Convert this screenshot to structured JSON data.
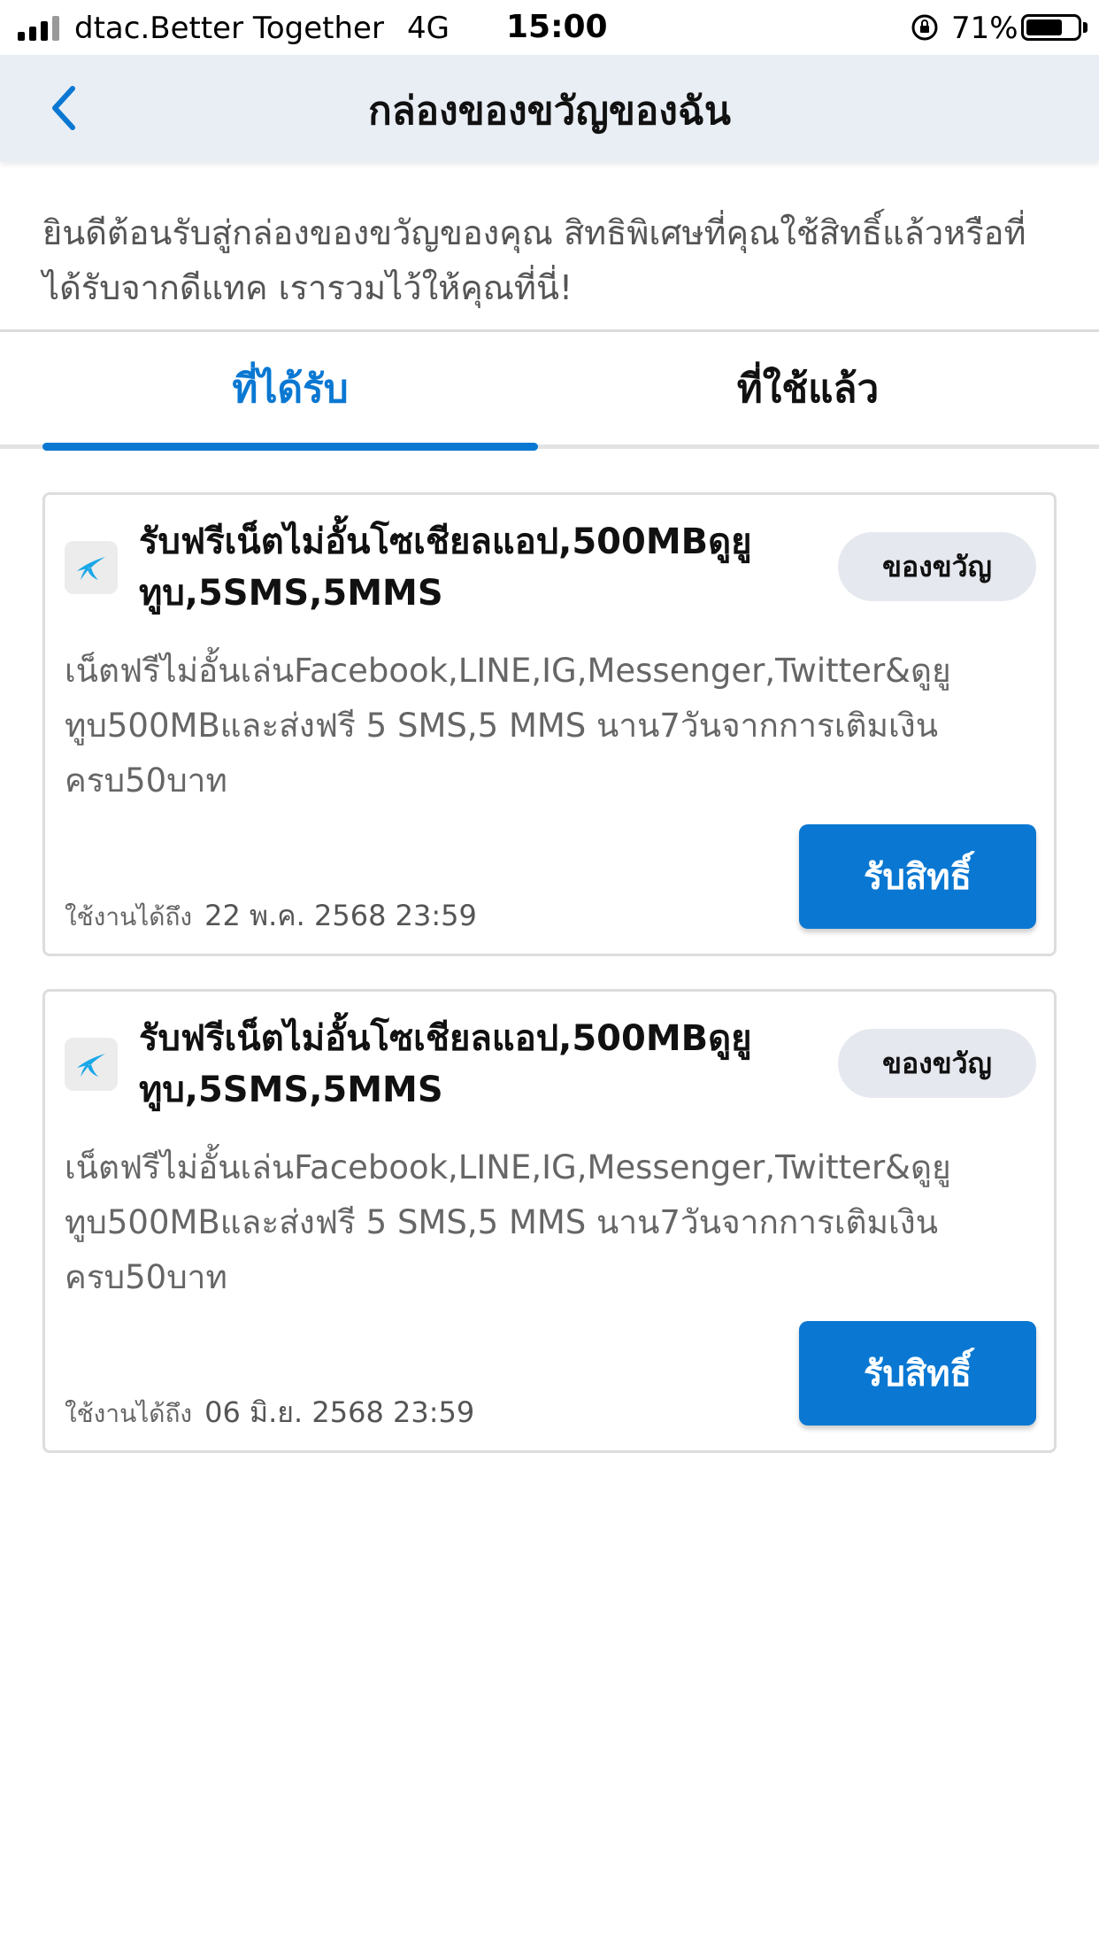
{
  "status_bar": {
    "carrier": "dtac.Better Together",
    "network": "4G",
    "time": "15:00",
    "battery": "71%",
    "battery_level": 0.71
  },
  "nav": {
    "title": "กล่องของขวัญของฉัน",
    "back_icon": "chevron-left-icon"
  },
  "intro_text": "ยินดีต้อนรับสู่กล่องของขวัญของคุณ สิทธิพิเศษที่คุณใช้สิทธิ์แล้วหรือที่ได้รับจากดีแทค เรารวมไว้ให้คุณที่นี่!",
  "tabs": [
    {
      "label": "ที่ได้รับ",
      "active": true
    },
    {
      "label": "ที่ใช้แล้ว",
      "active": false
    }
  ],
  "accent_color": "#0a78d2",
  "cards": [
    {
      "title": "รับฟรีเน็ตไม่อั้นโซเชียลแอป,500MBดูยูทูบ,5SMS,5MMS",
      "badge": "ของขวัญ",
      "description": "เน็ตฟรีไม่อั้นเล่นFacebook,LINE,IG,Messenger,Twitter&ดูยูทูบ500MBและส่งฟรี 5 SMS,5 MMS นาน7วันจากการเติมเงินครบ50บาท",
      "expiry_label": "ใช้งานได้ถึง",
      "expiry_date": "22 พ.ค. 2568 23:59",
      "button": "รับสิทธิ์"
    },
    {
      "title": "รับฟรีเน็ตไม่อั้นโซเชียลแอป,500MBดูยูทูบ,5SMS,5MMS",
      "badge": "ของขวัญ",
      "description": "เน็ตฟรีไม่อั้นเล่นFacebook,LINE,IG,Messenger,Twitter&ดูยูทูบ500MBและส่งฟรี 5 SMS,5 MMS นาน7วันจากการเติมเงินครบ50บาท",
      "expiry_label": "ใช้งานได้ถึง",
      "expiry_date": "06 มิ.ย. 2568 23:59",
      "button": "รับสิทธิ์"
    }
  ]
}
